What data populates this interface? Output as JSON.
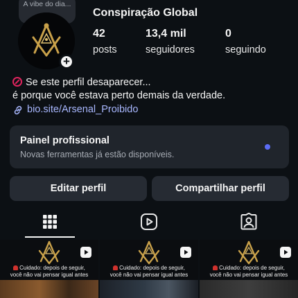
{
  "profile": {
    "note": "A vibe do dia...",
    "name": "Conspiração Global",
    "stats": [
      {
        "value": "42",
        "label": "posts"
      },
      {
        "value": "13,4 mil",
        "label": "seguidores"
      },
      {
        "value": "0",
        "label": "seguindo"
      }
    ],
    "bio_line1": "Se este perfil desaparecer...",
    "bio_line2": "é porque você estava perto demais da verdade.",
    "link": "bio.site/Arsenal_Proibido"
  },
  "pro_panel": {
    "title": "Painel profissional",
    "subtitle": "Novas ferramentas já estão disponíveis."
  },
  "buttons": {
    "edit": "Editar perfil",
    "share": "Compartilhar perfil"
  },
  "tabs": [
    {
      "icon": "grid-icon",
      "selected": true
    },
    {
      "icon": "reels-icon",
      "selected": false
    },
    {
      "icon": "tagged-icon",
      "selected": false
    }
  ],
  "posts": [
    {
      "caption_line1": "Cuidado: depois de seguir,",
      "caption_line2": "você não vai pensar igual antes",
      "icon": "reel-icon"
    },
    {
      "caption_line1": "Cuidado: depois de seguir,",
      "caption_line2": "você não vai pensar igual antes",
      "icon": "reel-icon"
    },
    {
      "caption_line1": "Cuidado: depois de seguir,",
      "caption_line2": "você não vai pensar igual antes",
      "icon": "reel-icon"
    }
  ],
  "colors": {
    "background": "#0c1014",
    "panel": "#20252c",
    "button": "#262b33",
    "link": "#a9b8ff",
    "notification_dot": "#5b6cf5",
    "logo_gold": "#c9a14a"
  }
}
